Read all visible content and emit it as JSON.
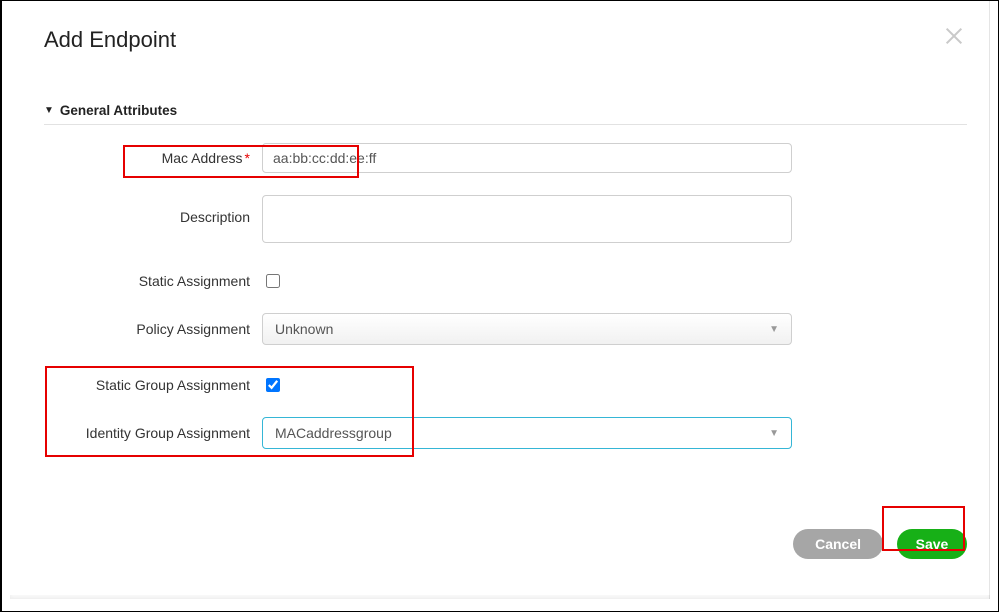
{
  "title": "Add Endpoint",
  "section_label": "General Attributes",
  "form": {
    "mac_label": "Mac Address",
    "mac_value": "aa:bb:cc:dd:ee:ff",
    "desc_label": "Description",
    "desc_value": "",
    "static_assign_label": "Static Assignment",
    "static_assign_checked": false,
    "policy_assign_label": "Policy Assignment",
    "policy_assign_value": "Unknown",
    "static_group_label": "Static Group Assignment",
    "static_group_checked": true,
    "identity_group_label": "Identity Group Assignment",
    "identity_group_value": "MACaddressgroup"
  },
  "buttons": {
    "cancel": "Cancel",
    "save": "Save"
  }
}
